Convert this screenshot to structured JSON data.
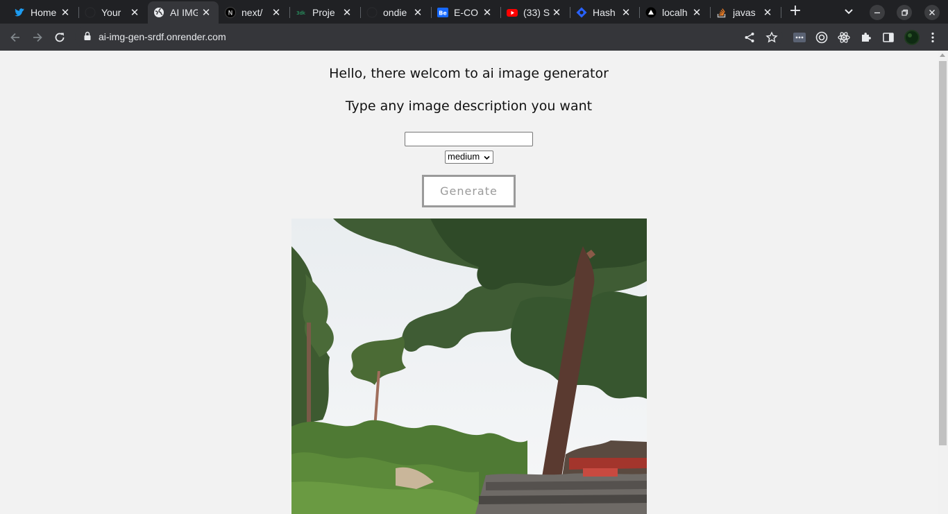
{
  "browser": {
    "tabs": [
      {
        "title": "Home",
        "icon": "twitter-icon",
        "active": false
      },
      {
        "title": "Your",
        "icon": "github-icon",
        "active": false
      },
      {
        "title": "AI IMG",
        "icon": "globe-icon",
        "active": true
      },
      {
        "title": "next/",
        "icon": "nextjs-icon",
        "active": false
      },
      {
        "title": "Proje",
        "icon": "project-icon",
        "active": false
      },
      {
        "title": "ondie",
        "icon": "github-icon",
        "active": false
      },
      {
        "title": "E-CO",
        "icon": "behance-icon",
        "active": false
      },
      {
        "title": "(33) S",
        "icon": "youtube-icon",
        "active": false
      },
      {
        "title": "Hash",
        "icon": "hashnode-icon",
        "active": false
      },
      {
        "title": "localh",
        "icon": "vercel-icon",
        "active": false
      },
      {
        "title": "javas",
        "icon": "stackoverflow-icon",
        "active": false
      }
    ],
    "close_glyph": "✕",
    "new_tab_glyph": "+",
    "url": "ai-img-gen-srdf.onrender.com"
  },
  "page": {
    "heading": "Hello, there welcom to ai image generator",
    "subheading": "Type any image description you want",
    "prompt_value": "",
    "size_selected": "medium",
    "generate_label": "Generate"
  },
  "colors": {
    "tab_strip": "#202124",
    "toolbar": "#35363a",
    "page_bg": "#f2f2f2",
    "button_border": "#9a9a9a"
  }
}
